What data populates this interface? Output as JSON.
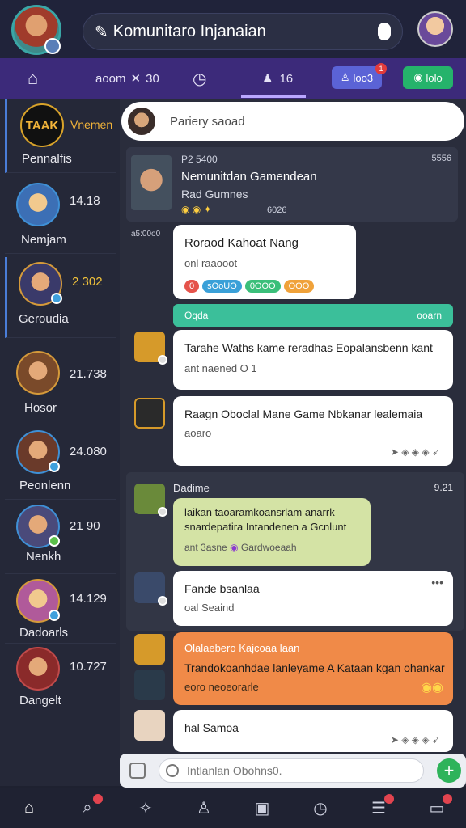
{
  "header": {
    "title": "Komunitaro Injanaian"
  },
  "toolbar": {
    "item1": "aoom",
    "item1_num": "30",
    "item3_num": "16",
    "pill_blue": "loo3",
    "pill_green": "lolo",
    "pill_blue_badge": "1"
  },
  "sidebar": {
    "items": [
      {
        "name": "Pennalfis",
        "count": "",
        "tag": "Vnemen",
        "logo": "TAAK"
      },
      {
        "name": "Nemjam",
        "count": "14.18"
      },
      {
        "name": "Geroudia",
        "count": "2 302"
      },
      {
        "name": "Hosor",
        "count": "21.738"
      },
      {
        "name": "Peonlenn",
        "count": "24.080"
      },
      {
        "name": "Nenkh",
        "count": "21 90"
      },
      {
        "name": "Dadoarls",
        "count": "14.129"
      },
      {
        "name": "Dangelt",
        "count": "10.727"
      }
    ]
  },
  "main": {
    "banner": "Pariery saoad",
    "card": {
      "meta": "P2 5400",
      "meta_r": "5556",
      "t1": "Nemunitdan Gamendean",
      "t2": "Rad Gumnes",
      "t3": "6026"
    },
    "stamp1": "a5:00o0",
    "bubble1": {
      "l1": "Roraod Kahoat Nang",
      "l2": "onl raaooot",
      "pills": [
        "0",
        "sOoUO",
        "0OOO",
        "OOO"
      ]
    },
    "green_bar": {
      "left": "Oqda",
      "right": "ooarn"
    },
    "bubble2": {
      "l1": "Tarahe Waths",
      "l1b": "kame reradhas Eopalansbenn kant",
      "l2": "ant naened O 1"
    },
    "bubble3": {
      "l1": "Raagn Oboclal Mane Game Nbkanar lealemaia",
      "l2": "aoaro"
    },
    "group": {
      "title": "Dadime",
      "time": "9.21"
    },
    "bubble4": {
      "l1": "laikan taoaramkoansrlam anarrk",
      "l2": "snardepatira Intandenen a Gcnlunt",
      "l3": "ant 3asne",
      "l3b": "Gardwoeaah"
    },
    "bubble5": {
      "l1": "Fande bsanlaa",
      "l2": "oal Seaind"
    },
    "bubble6": {
      "title": "Olalaebero Kajcoaa laan",
      "l1": "Trandokoanhdae lanleyame A Kataan kgan ohankar",
      "l2": "eoro neoeorarle"
    },
    "bubble7": {
      "l1": "hal Samoa"
    }
  },
  "composer": {
    "placeholder": "Intlanlan Obohns0."
  }
}
